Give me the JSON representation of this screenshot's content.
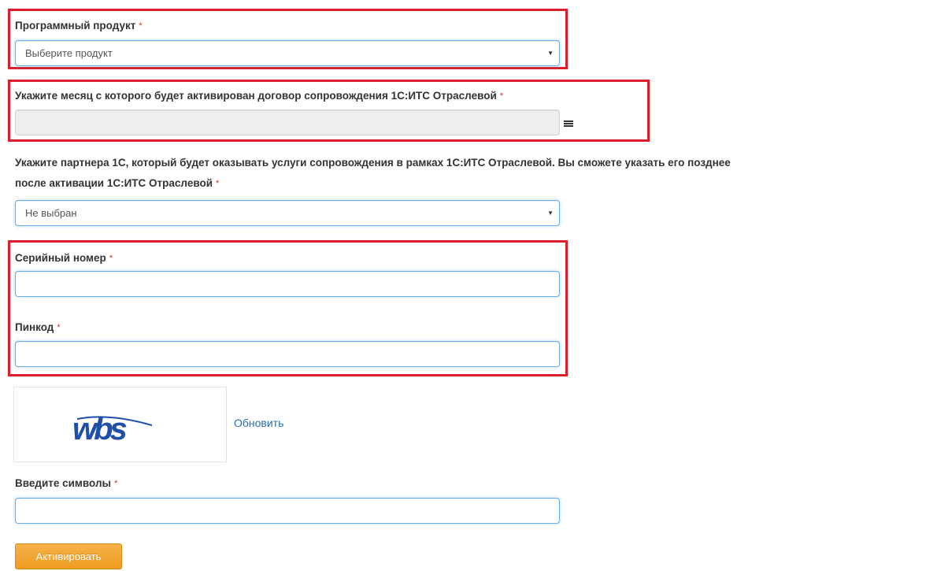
{
  "form": {
    "product": {
      "label": "Программный продукт",
      "required_mark": "*",
      "placeholder": "Выберите продукт"
    },
    "activation_month": {
      "label": "Укажите месяц с которого будет активирован договор сопровождения 1С:ИТС Отраслевой",
      "required_mark": "*",
      "value": ""
    },
    "partner": {
      "label_line1": "Укажите партнера 1С, который будет оказывать услуги сопровождения в рамках 1С:ИТС Отраслевой. Вы сможете указать его позднее",
      "label_line2": "после активации 1С:ИТС Отраслевой",
      "required_mark": "*",
      "selected": "Не выбран"
    },
    "serial": {
      "label": "Серийный номер",
      "required_mark": "*",
      "value": ""
    },
    "pin": {
      "label": "Пинкод",
      "required_mark": "*",
      "value": ""
    },
    "captcha": {
      "image_text": "wbs",
      "refresh_label": "Обновить"
    },
    "captcha_input": {
      "label": "Введите символы",
      "required_mark": "*",
      "value": ""
    },
    "submit_label": "Активировать"
  },
  "colors": {
    "highlight_border": "#dc1f2e",
    "focus_border": "#66afe9",
    "button": "#ee9c1f",
    "link": "#2a6fad",
    "captcha_text": "#1f4fa8"
  },
  "icons": {
    "calendar": "calendar-icon",
    "select_arrow": "caret-down-icon"
  }
}
